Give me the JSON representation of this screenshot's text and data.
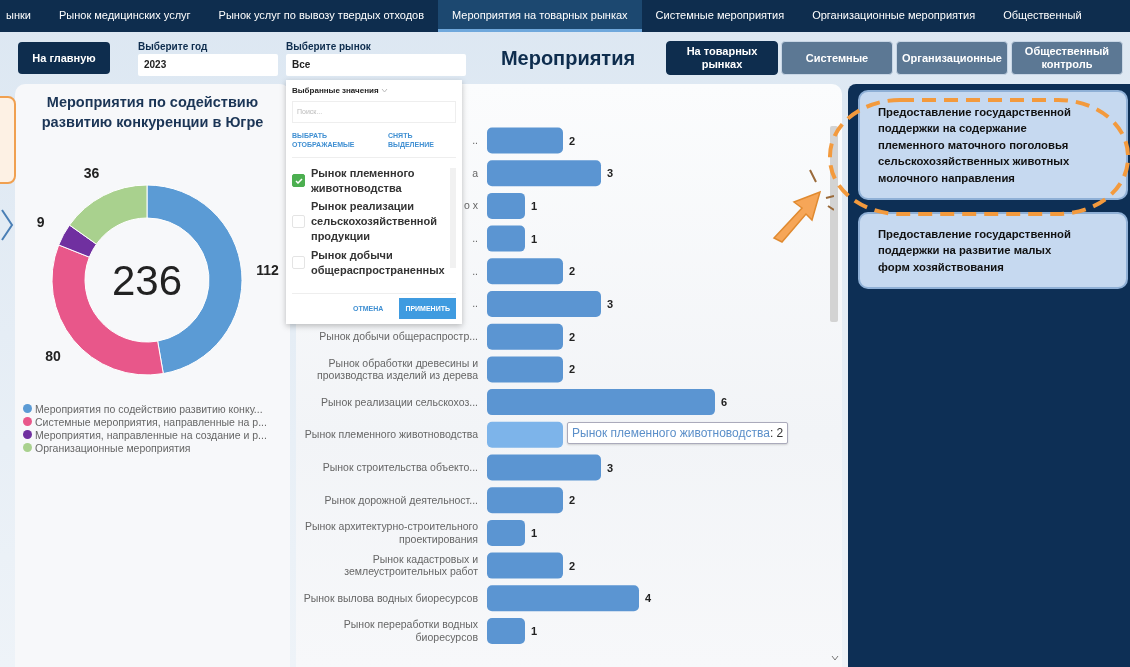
{
  "nav_tabs": [
    {
      "label": "ынки",
      "selected": false
    },
    {
      "label": "Рынок медицинских услуг",
      "selected": false
    },
    {
      "label": "Рынок услуг по вывозу твердых отходов",
      "selected": false
    },
    {
      "label": "Мероприятия на товарных рынках",
      "selected": true
    },
    {
      "label": "Системные мероприятия",
      "selected": false
    },
    {
      "label": "Организационные мероприятия",
      "selected": false
    },
    {
      "label": "Общественный",
      "selected": false
    }
  ],
  "header": {
    "home_button": "На главную",
    "year": {
      "label": "Выберите год",
      "value": "2023"
    },
    "market": {
      "label": "Выберите рынок",
      "value": "Все"
    },
    "title": "Мероприятия",
    "view_buttons": [
      {
        "label": "На товарных рынках",
        "selected": true
      },
      {
        "label": "Системные",
        "selected": false
      },
      {
        "label": "Организационные",
        "selected": false
      },
      {
        "label": "Общественный контроль",
        "selected": false
      }
    ]
  },
  "market_dropdown": {
    "heading": "Выбранные значения",
    "search": {
      "placeholder": "Поиск..."
    },
    "links": [
      "ВЫБРАТЬ ОТОБРАЖАЕМЫЕ",
      "СНЯТЬ ВЫДЕЛЕНИЕ"
    ],
    "options": [
      {
        "label": "Рынок племенного животноводства",
        "checked": true
      },
      {
        "label": "Рынок реализации сельскохозяйственной продукции",
        "checked": false
      },
      {
        "label": "Рынок добычи общераспространенных",
        "checked": false
      }
    ],
    "buttons": [
      "ОТМЕНА",
      "ПРИМЕНИТЬ"
    ]
  },
  "donut_panel": {
    "title": "Мероприятия по содействию развитию конкуренции в Югре",
    "total": "236",
    "legend": [
      {
        "color": "#5b9bd5"
      },
      {
        "color": "#e8578a"
      },
      {
        "color": "#7030a0"
      },
      {
        "color": "#a9d18e"
      }
    ],
    "chart_data": {
      "type": "donut",
      "categories": [
        "Мероприятия по содействию развитию конку...",
        "Системные мероприятия, направленные на р...",
        "Мероприятия, направленные на создание и р...",
        "Организационные мероприятия"
      ],
      "values": [
        112,
        80,
        9,
        36
      ],
      "data_labels": true
    }
  },
  "bar_panel": {
    "chart_data": {
      "type": "bar",
      "orientation": "horizontal",
      "categories": [
        "..",
        "а",
        "о х",
        "..",
        "..",
        "..",
        "Рынок добычи общераспростр...",
        "Рынок обработки древесины и производства изделий из дерева",
        "Рынок реализации сельскохоз...",
        "Рынок племенного животноводства",
        "Рынок строительства объекто...",
        "Рынок дорожной деятельност...",
        "Рынок архитектурно-строительного проектирования",
        "Рынок кадастровых и землеустроительных работ",
        "Рынок вылова водных биоресурсов",
        "Рынок переработки водных биоресурсов"
      ],
      "values": [
        2,
        3,
        1,
        1,
        2,
        3,
        2,
        2,
        6,
        2,
        3,
        2,
        1,
        2,
        4,
        1
      ],
      "value_labels": [
        "2",
        "3",
        "1",
        "1",
        "2",
        "3",
        "2",
        "2",
        "6",
        null,
        "3",
        "2",
        "1",
        "2",
        "4",
        "1"
      ]
    },
    "bar_states": [
      {
        "selected": false
      },
      {
        "selected": false
      },
      {
        "selected": false
      },
      {
        "selected": false
      },
      {
        "selected": false
      },
      {
        "selected": false
      },
      {
        "selected": false
      },
      {
        "selected": false
      },
      {
        "selected": false
      },
      {
        "selected": true
      },
      {
        "selected": false
      },
      {
        "selected": false
      },
      {
        "selected": false
      },
      {
        "selected": false
      },
      {
        "selected": false
      },
      {
        "selected": false
      }
    ],
    "tooltip": {
      "label": "Рынок племенного животноводства",
      "value": ": 2"
    }
  },
  "right_panel": {
    "cards": [
      "Предоставление государственной поддержки на содержание племенного маточного поголовья сельскохозяйственных животных молочного направления",
      "Предоставление государственной поддержки на развитие малых форм хозяйствования"
    ]
  }
}
